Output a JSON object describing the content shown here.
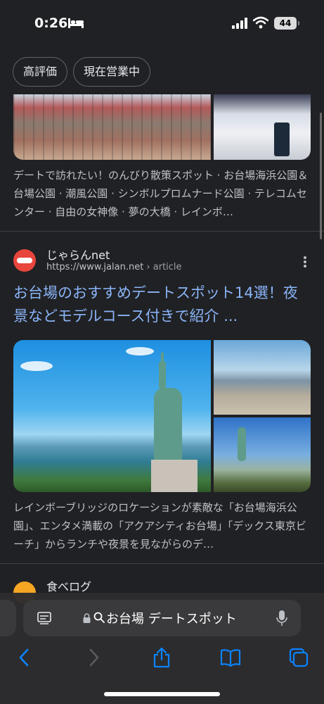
{
  "status_bar": {
    "time": "0:26",
    "battery": "44",
    "icons": [
      "bed-icon",
      "signal-icon",
      "wifi-icon",
      "battery-icon"
    ]
  },
  "chips": [
    {
      "label": "高評価"
    },
    {
      "label": "現在営業中"
    }
  ],
  "result0": {
    "snippet": "デートで訪れたい！のんびり散策スポット · お台場海浜公園＆台場公園 · 潮風公園 · シンボルプロムナード公園 · テレコムセンター · 自由の女神像 · 夢の大橋 · レインボ…"
  },
  "result1": {
    "site_name": "じゃらんnet",
    "url": "https://www.jalan.net",
    "crumb": " › article",
    "title": "お台場のおすすめデートスポット14選！夜景などモデルコース付きで紹介 ...",
    "snippet": "レインボーブリッジのロケーションが素敵な「お台場海浜公園」、エンタメ満載の「アクアシティお台場」「デックス東京ビーチ」からランチや夜景を見ながらのデ…"
  },
  "result2": {
    "site_name": "食べログ"
  },
  "address_bar": {
    "text": "お台場 デートスポット"
  },
  "colors": {
    "background": "#202124",
    "link": "#8ab4f8",
    "toolbar_icon": "#0a84ff"
  }
}
